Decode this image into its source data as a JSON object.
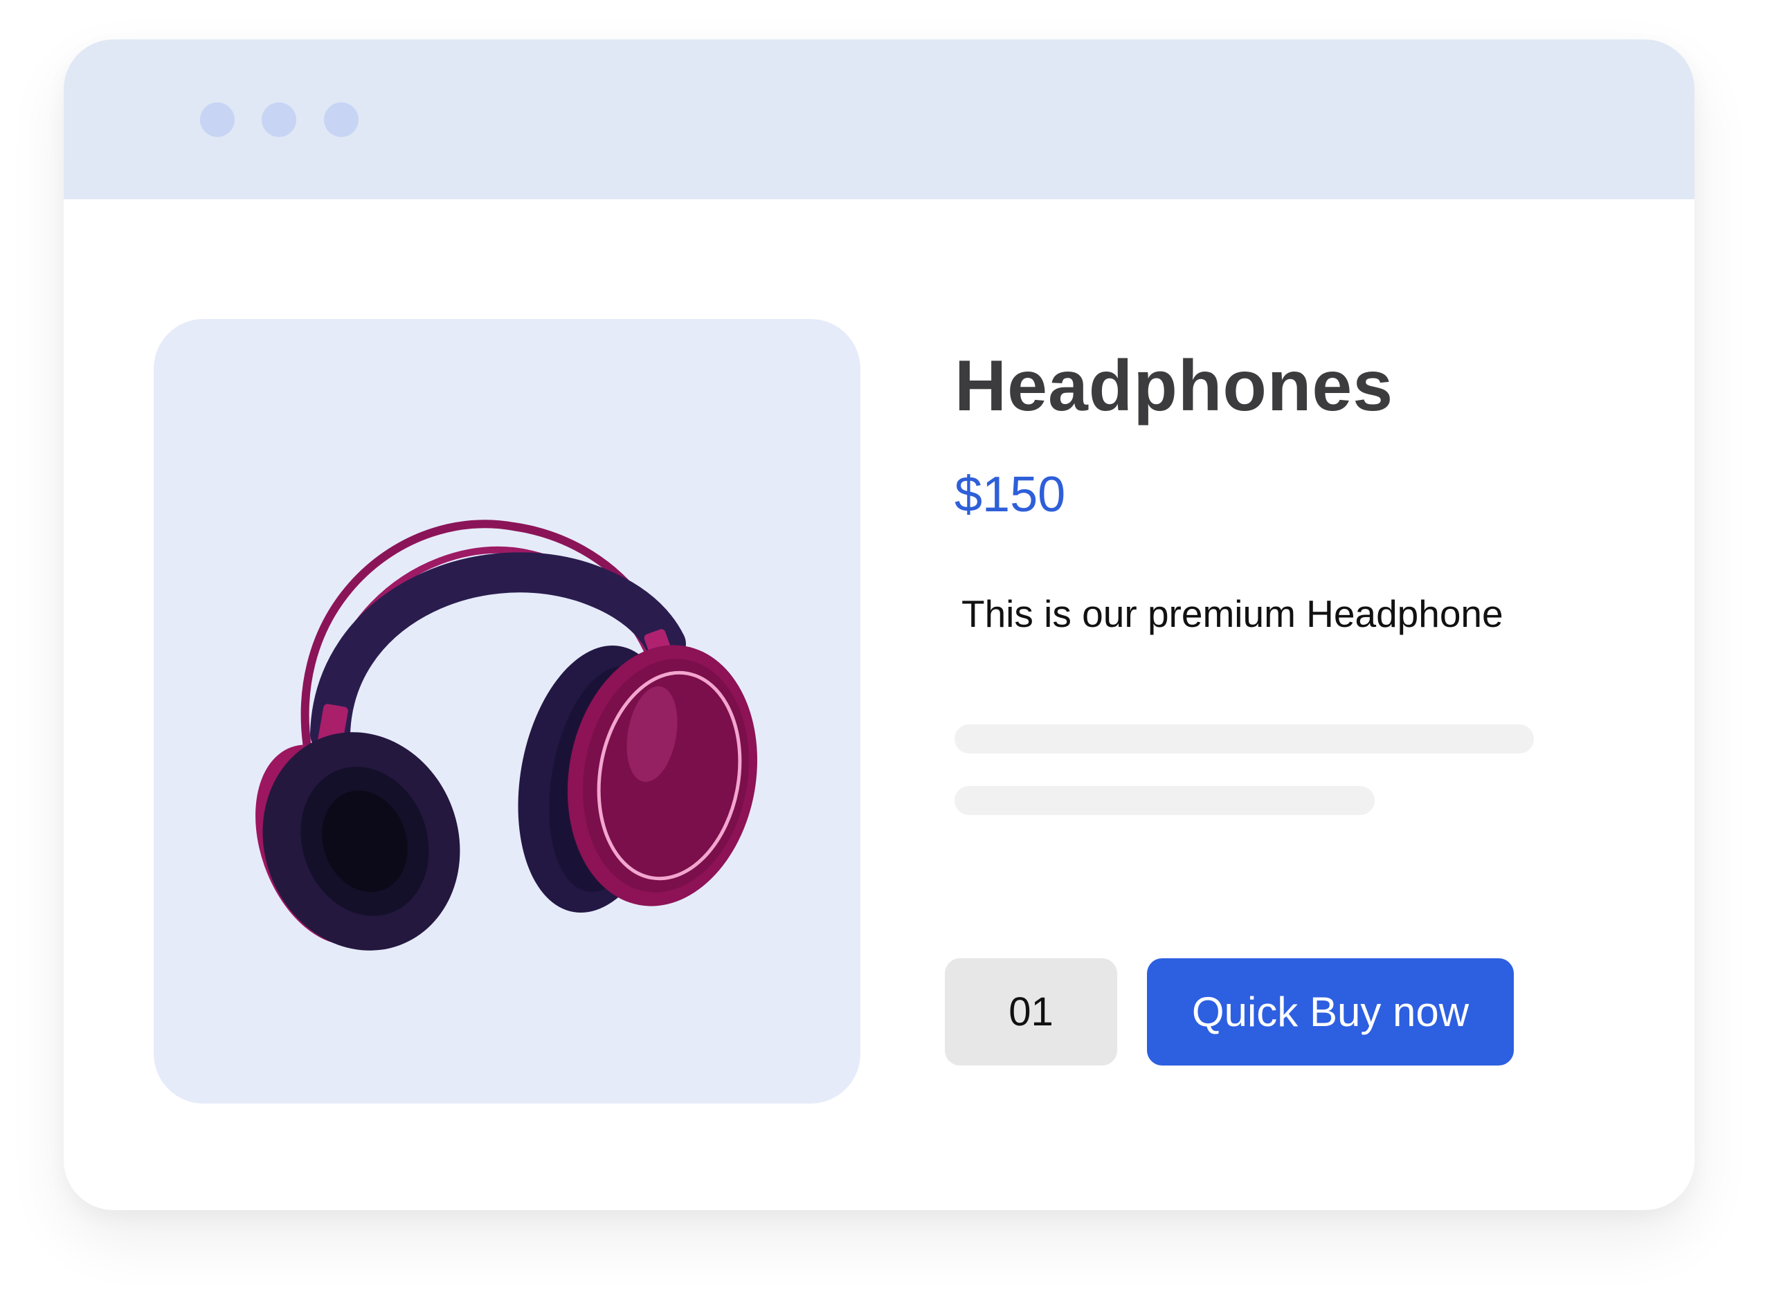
{
  "window": {
    "controls": [
      "close-dot",
      "minimize-dot",
      "maximize-dot"
    ]
  },
  "product": {
    "title": "Headphones",
    "price": "$150",
    "description": "This is our premium Headphone",
    "image_icon": "headphones-image"
  },
  "purchase": {
    "quantity": "01",
    "buy_label": "Quick Buy now"
  },
  "colors": {
    "titlebar": "#e0e8f5",
    "window_dots": "#c7d4f4",
    "image_background": "#e6ebfa",
    "price": "#2e5fd9",
    "buy_button": "#2d5fe1",
    "quantity_box": "#e7e7e8",
    "skeleton": "#f1f1f2"
  }
}
